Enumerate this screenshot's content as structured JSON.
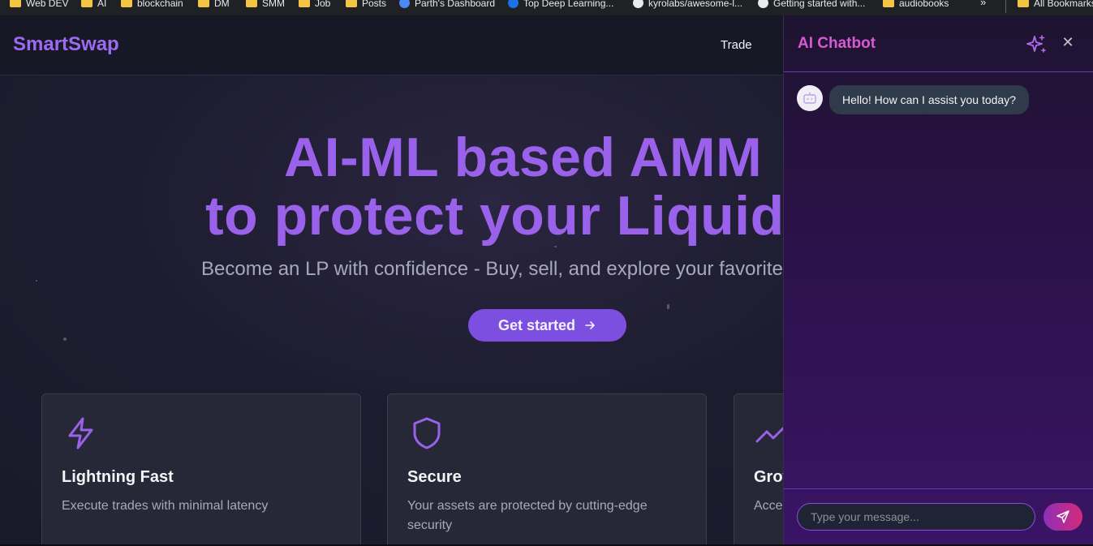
{
  "bookmarks": {
    "items": [
      {
        "label": "Web DEV",
        "icon": "folder-icon"
      },
      {
        "label": "AI",
        "icon": "folder-icon"
      },
      {
        "label": "blockchain",
        "icon": "folder-icon"
      },
      {
        "label": "DM",
        "icon": "folder-icon"
      },
      {
        "label": "SMM",
        "icon": "folder-icon"
      },
      {
        "label": "Job",
        "icon": "folder-icon"
      },
      {
        "label": "Posts",
        "icon": "folder-icon"
      },
      {
        "label": "Parth's Dashboard",
        "icon": "site-icon"
      },
      {
        "label": "Top Deep Learning...",
        "icon": "site-icon"
      },
      {
        "label": "kyrolabs/awesome-l...",
        "icon": "github-icon"
      },
      {
        "label": "Getting started with...",
        "icon": "github-icon"
      },
      {
        "label": "audiobooks",
        "icon": "folder-icon"
      }
    ],
    "more": "»",
    "all_bookmarks": "All Bookmarks"
  },
  "nav": {
    "brand": "SmartSwap",
    "trade": "Trade"
  },
  "hero": {
    "title_line1": "AI-ML based AMM",
    "title_line2": "to protect your Liquidity",
    "subtitle": "Become an LP with confidence - Buy, sell, and explore your favorite tokens",
    "cta": "Get started"
  },
  "features": [
    {
      "title": "Lightning Fast",
      "desc": "Execute trades with minimal latency",
      "icon": "lightning-icon"
    },
    {
      "title": "Secure",
      "desc": "Your assets are protected by cutting-edge security",
      "icon": "shield-icon"
    },
    {
      "title": "Growth",
      "desc": "Access",
      "icon": "trending-up-icon"
    }
  ],
  "chat": {
    "title": "AI Chatbot",
    "messages": [
      {
        "from": "bot",
        "text": "Hello! How can I assist you today?"
      }
    ],
    "input_placeholder": "Type your message..."
  },
  "colors": {
    "accent": "#9a62ea",
    "button": "#7d4fe0",
    "chat_title": "#d65bd2"
  }
}
